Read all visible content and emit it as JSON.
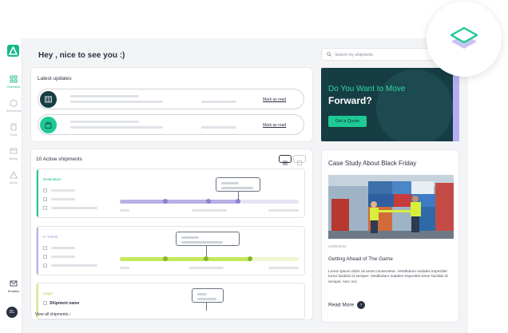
{
  "sidebar": {
    "items": [
      {
        "label": "Overview",
        "icon": "grid-icon",
        "active": true
      },
      {
        "label": "Shipments",
        "icon": "box-icon",
        "active": false
      },
      {
        "label": "Tools",
        "icon": "calculator-icon",
        "active": false
      },
      {
        "label": "Billing",
        "icon": "card-icon",
        "active": false
      },
      {
        "label": "Alerts",
        "icon": "warning-icon",
        "active": false
      }
    ],
    "bottom_item": {
      "label": "Emailus",
      "icon": "mail-icon"
    },
    "avatar_initials": "DL"
  },
  "header": {
    "greeting": "Hey , nice to see you :)",
    "search_placeholder": "Search my shipments"
  },
  "updates": {
    "title": "Latest updates",
    "items": [
      {
        "icon": "container-icon",
        "icon_bg": "#163d43",
        "action": "Mark as read"
      },
      {
        "icon": "lock-box-icon",
        "icon_bg": "#1ec995",
        "action": "Mark as read"
      }
    ]
  },
  "shipments": {
    "title": "10 Active shipments",
    "cards": [
      {
        "status": "Destination",
        "color": "#1ec995",
        "track_color": "#b7b1e4",
        "track_fill": 0.66
      },
      {
        "status": "In Transit",
        "color": "#b7b1e4",
        "track_color": "#c5e85a",
        "track_fill": 0.73
      },
      {
        "status": "Origin",
        "color": "#d8ec7a",
        "shipment_name": "Shipment name"
      }
    ],
    "view_all": "View all shipments"
  },
  "promo": {
    "line1": "Do You Want to Move",
    "line2": "Forward?",
    "cta": "Get a Quote"
  },
  "case_study": {
    "title": "Case Study About Black Friday",
    "date": "24/05/2022",
    "headline": "Getting Ahead of The Game",
    "body": "Lorem ipsum dolor sit amet consectetur. Vestibulum sodales imperdiet tortor facilisis id semper. Vestibulum sodales imperdiet tortor facilisis id semper. Nec orci",
    "read_more": "Read More"
  },
  "colors": {
    "brand": "#1ec995",
    "dark": "#163d43",
    "lavender": "#b6aef0"
  }
}
